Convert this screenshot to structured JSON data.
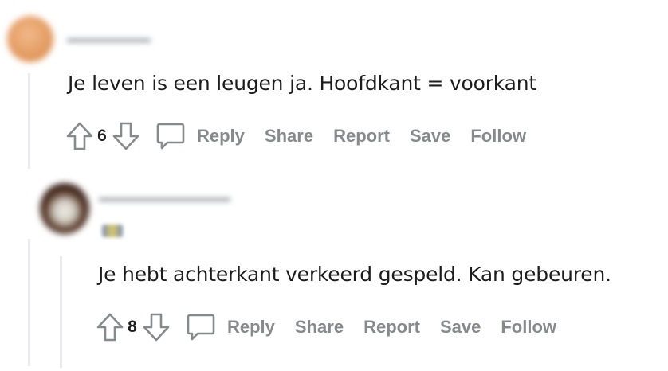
{
  "colors": {
    "thread_line": "#e9eaeb",
    "action_text": "#878a8c",
    "body_text": "#1c1c1c",
    "icon_stroke": "#878a8c"
  },
  "icons": [
    "upvote-arrow-icon",
    "downvote-arrow-icon",
    "comment-bubble-icon"
  ],
  "comments": [
    {
      "body": "Je leven is een leugen ja. Hoofdkant = voorkant",
      "votes": "6",
      "actions": {
        "reply": "Reply",
        "share": "Share",
        "report": "Report",
        "save": "Save",
        "follow": "Follow"
      }
    },
    {
      "body": "Je hebt achterkant verkeerd gespeld. Kan gebeuren.",
      "votes": "8",
      "actions": {
        "reply": "Reply",
        "share": "Share",
        "report": "Report",
        "save": "Save",
        "follow": "Follow"
      }
    }
  ]
}
